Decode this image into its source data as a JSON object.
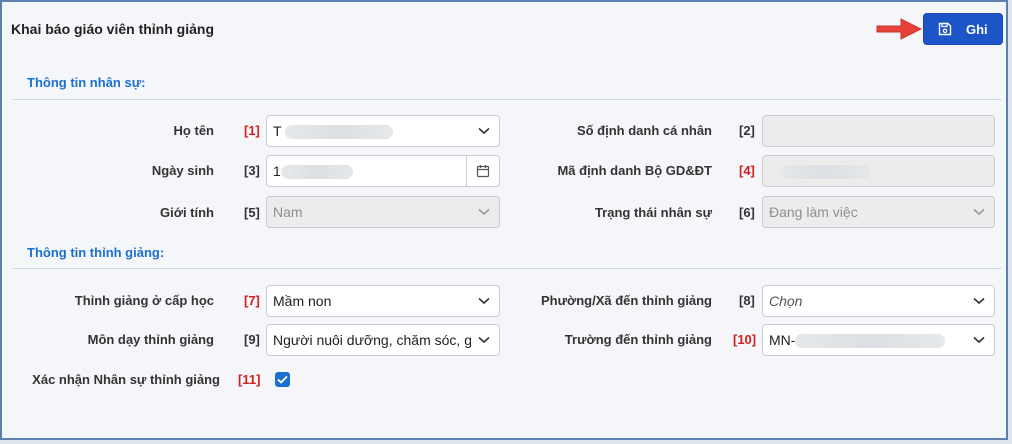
{
  "header": {
    "title": "Khai báo giáo viên thỉnh giảng",
    "save_label": "Ghi"
  },
  "sections": {
    "personal": {
      "title": "Thông tin nhân sự:"
    },
    "guest": {
      "title": "Thông tin thỉnh giảng:"
    }
  },
  "fields": {
    "ho_ten": {
      "label": "Họ tên",
      "num": "[1]",
      "value": "T"
    },
    "so_dinh_danh": {
      "label": "Số định danh cá nhân",
      "num": "[2]",
      "value": ""
    },
    "ngay_sinh": {
      "label": "Ngày sinh",
      "num": "[3]",
      "value": "1"
    },
    "ma_dinh_danh": {
      "label": "Mã định danh Bộ GD&ĐT",
      "num": "[4]",
      "value": ""
    },
    "gioi_tinh": {
      "label": "Giới tính",
      "num": "[5]",
      "value": "Nam"
    },
    "trang_thai": {
      "label": "Trạng thái nhân sự",
      "num": "[6]",
      "value": "Đang làm việc"
    },
    "cap_hoc": {
      "label": "Thỉnh giảng ở cấp học",
      "num": "[7]",
      "value": "Mầm non"
    },
    "phuong_xa": {
      "label": "Phường/Xã đến thỉnh giảng",
      "num": "[8]",
      "placeholder": "Chọn"
    },
    "mon_day": {
      "label": "Môn dạy thỉnh giảng",
      "num": "[9]",
      "value": "Người nuôi dưỡng, chăm sóc, g"
    },
    "truong": {
      "label": "Trường đến thỉnh giảng",
      "num": "[10]",
      "value": "MN-"
    },
    "xac_nhan": {
      "label": "Xác nhận Nhân sự thỉnh giảng",
      "num": "[11]",
      "checked": true
    }
  },
  "colors": {
    "accent": "#1c55c7",
    "section": "#1c6fd1",
    "required": "#d21f1f",
    "arrow": "#e8413a"
  }
}
